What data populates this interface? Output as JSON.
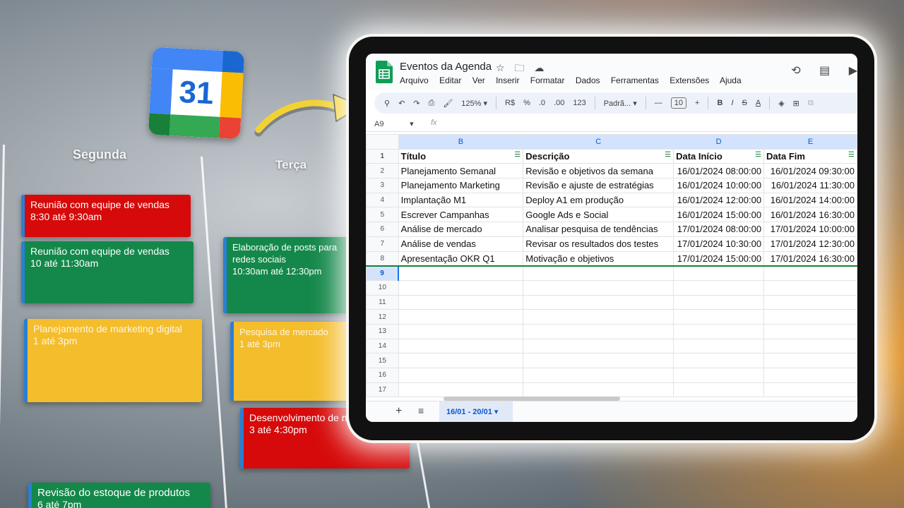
{
  "calendar": {
    "days": [
      "Segunda",
      "Terça"
    ],
    "icon_number": "31",
    "monday_events": [
      {
        "title": "Reunião com equipe de vendas",
        "time": "8:30 até 9:30am",
        "color": "#d60a0a"
      },
      {
        "title": "Reunião com equipe de vendas",
        "time": "10 até 11:30am",
        "color": "#14884a"
      },
      {
        "title": "Planejamento de marketing digital",
        "time": "1 até 3pm",
        "color": "#f4bd2c"
      },
      {
        "title": "Revisão do estoque de produtos",
        "time": "6 até 7pm",
        "color": "#14884a"
      }
    ],
    "tuesday_events": [
      {
        "title": "Elaboração de posts para redes sociais",
        "time": "10:30am até 12:30pm",
        "color": "#14884a"
      },
      {
        "title": "Pesquisa de mercado",
        "time": "1 até 3pm",
        "color": "#f4bd2c"
      },
      {
        "title": "Desenvolvimento de novos",
        "time": "3 até 4:30pm",
        "color": "#d60a0a"
      }
    ]
  },
  "sheets": {
    "doc_title": "Eventos da Agenda",
    "menu": [
      "Arquivo",
      "Editar",
      "Ver",
      "Inserir",
      "Formatar",
      "Dados",
      "Ferramentas",
      "Extensões",
      "Ajuda"
    ],
    "toolbar": {
      "zoom": "125%",
      "currency": "R$",
      "percent": "%",
      "dec_less": ".0",
      "dec_more": ".00",
      "format_123": "123",
      "font": "Padrã...",
      "font_size": "10"
    },
    "name_box": "A9",
    "fx": "fx",
    "columns": [
      "B",
      "C",
      "D",
      "E"
    ],
    "header": [
      "Título",
      "Descrição",
      "Data Início",
      "Data Fim"
    ],
    "rows": [
      [
        "Planejamento Semanal",
        "Revisão e objetivos da semana",
        "16/01/2024 08:00:00",
        "16/01/2024 09:30:00"
      ],
      [
        "Planejamento Marketing",
        "Revisão e ajuste de estratégias",
        "16/01/2024 10:00:00",
        "16/01/2024 11:30:00"
      ],
      [
        "Implantação M1",
        "Deploy A1 em produção",
        "16/01/2024 12:00:00",
        "16/01/2024 14:00:00"
      ],
      [
        "Escrever Campanhas",
        "Google Ads e Social",
        "16/01/2024 15:00:00",
        "16/01/2024 16:30:00"
      ],
      [
        "Análise de mercado",
        "Analisar pesquisa de tendências",
        "17/01/2024 08:00:00",
        "17/01/2024 10:00:00"
      ],
      [
        "Análise de vendas",
        "Revisar os resultados dos testes",
        "17/01/2024 10:30:00",
        "17/01/2024 12:30:00"
      ],
      [
        "Apresentação OKR Q1",
        "Motivação e objetivos",
        "17/01/2024 15:00:00",
        "17/01/2024 16:30:00"
      ]
    ],
    "row_numbers": [
      "1",
      "2",
      "3",
      "4",
      "5",
      "6",
      "7",
      "8",
      "9",
      "10",
      "11",
      "12",
      "13",
      "14",
      "15",
      "16",
      "17"
    ],
    "sheet_tab": "16/01 - 20/01"
  }
}
